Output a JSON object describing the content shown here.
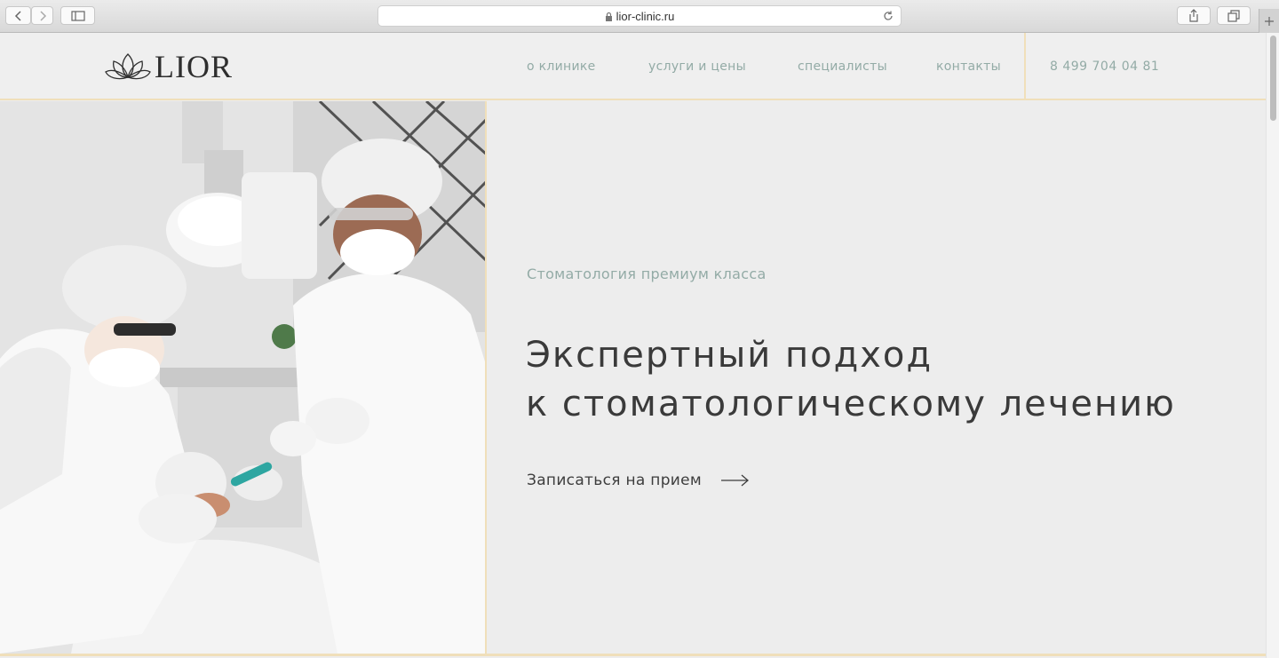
{
  "browser": {
    "url": "lior-clinic.ru"
  },
  "header": {
    "logo_text": "LIOR",
    "nav": [
      {
        "label": "о клинике"
      },
      {
        "label": "услуги и цены"
      },
      {
        "label": "специалисты"
      },
      {
        "label": "контакты"
      }
    ],
    "phone": "8 499 704 04 81"
  },
  "hero": {
    "subtitle": "Стоматология премиум класса",
    "headline_line1": "Экспертный подход",
    "headline_line2": "к стоматологическому лечению",
    "cta_label": "Записаться на прием"
  },
  "colors": {
    "accent_line": "#f0dfba",
    "nav_text": "#93aba6",
    "headline": "#3a3a3a"
  }
}
